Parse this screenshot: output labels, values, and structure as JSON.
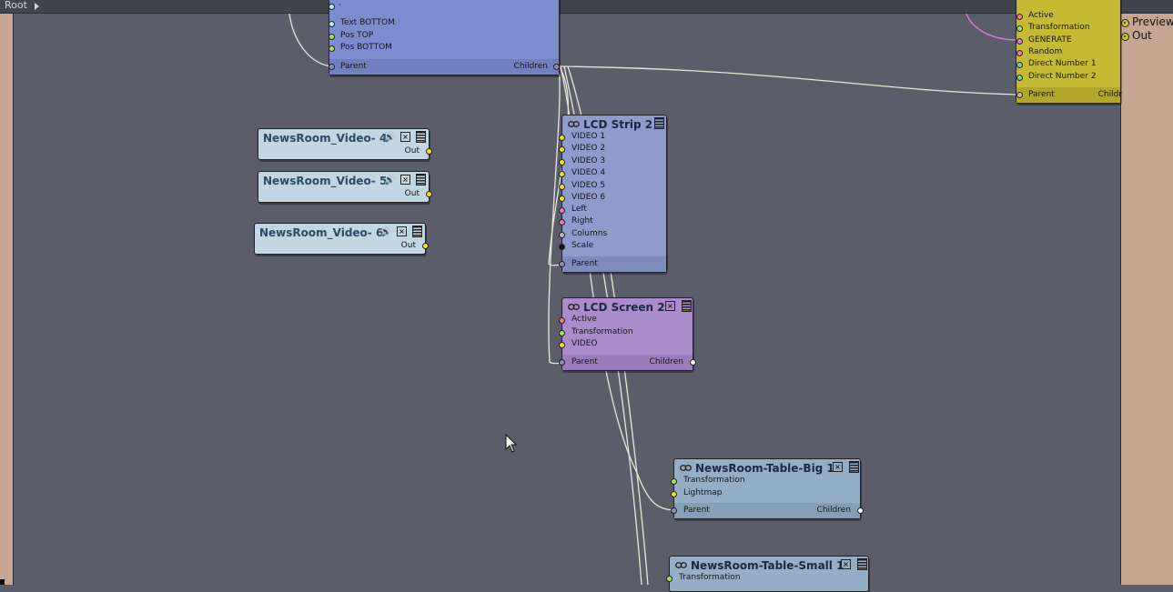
{
  "breadcrumb": {
    "root": "Root"
  },
  "preview_panel": {
    "preview_label": "Preview",
    "out_label": "Out"
  },
  "nodes": {
    "top_blue": {
      "inputs": [
        "Text BOTTOM",
        "Pos TOP",
        "Pos BOTTOM"
      ],
      "parent": "Parent",
      "children": "Children",
      "color": "#7b8ccf"
    },
    "top_yellow": {
      "inputs": [
        "Active",
        "Transformation",
        "GENERATE",
        "Random",
        "Direct Number 1",
        "Direct Number 2"
      ],
      "parent": "Parent",
      "children": "Childr",
      "color": "#c4ba33"
    },
    "video4": {
      "title": "NewsRoom_Video- 4",
      "out": "Out"
    },
    "video5": {
      "title": "NewsRoom_Video- 5",
      "out": "Out"
    },
    "video6": {
      "title": "NewsRoom_Video- 6",
      "out": "Out"
    },
    "lcd_strip": {
      "title": "LCD Strip 2",
      "inputs": [
        "VIDEO 1",
        "VIDEO 2",
        "VIDEO 3",
        "VIDEO 4",
        "VIDEO 5",
        "VIDEO 6",
        "Left",
        "Right",
        "Columns",
        "Scale"
      ],
      "parent": "Parent"
    },
    "lcd_screen": {
      "title": "LCD Screen 2",
      "inputs": [
        "Active",
        "Transformation",
        "VIDEO"
      ],
      "parent": "Parent",
      "children": "Children"
    },
    "table_big": {
      "title": "NewsRoom-Table-Big 1",
      "inputs": [
        "Transformation",
        "Lightmap"
      ],
      "parent": "Parent",
      "children": "Children"
    },
    "table_small": {
      "title": "NewsRoom-Table-Small 1",
      "inputs": [
        "Transformation"
      ]
    }
  },
  "colors": {
    "canvas": "#5b5d6a",
    "side_panel": "#c6a693",
    "video_node": "#c3d6e3",
    "lcd_strip": "#8f9bcb",
    "lcd_screen": "#ab8ccb",
    "table_node": "#94aec5",
    "wire": "#e8e6d8",
    "port_yellow": "#f2e21c",
    "port_green": "#a6e35a",
    "port_pink": "#e879c8",
    "port_red": "#f08080",
    "port_cyan": "#b6e6f2"
  }
}
